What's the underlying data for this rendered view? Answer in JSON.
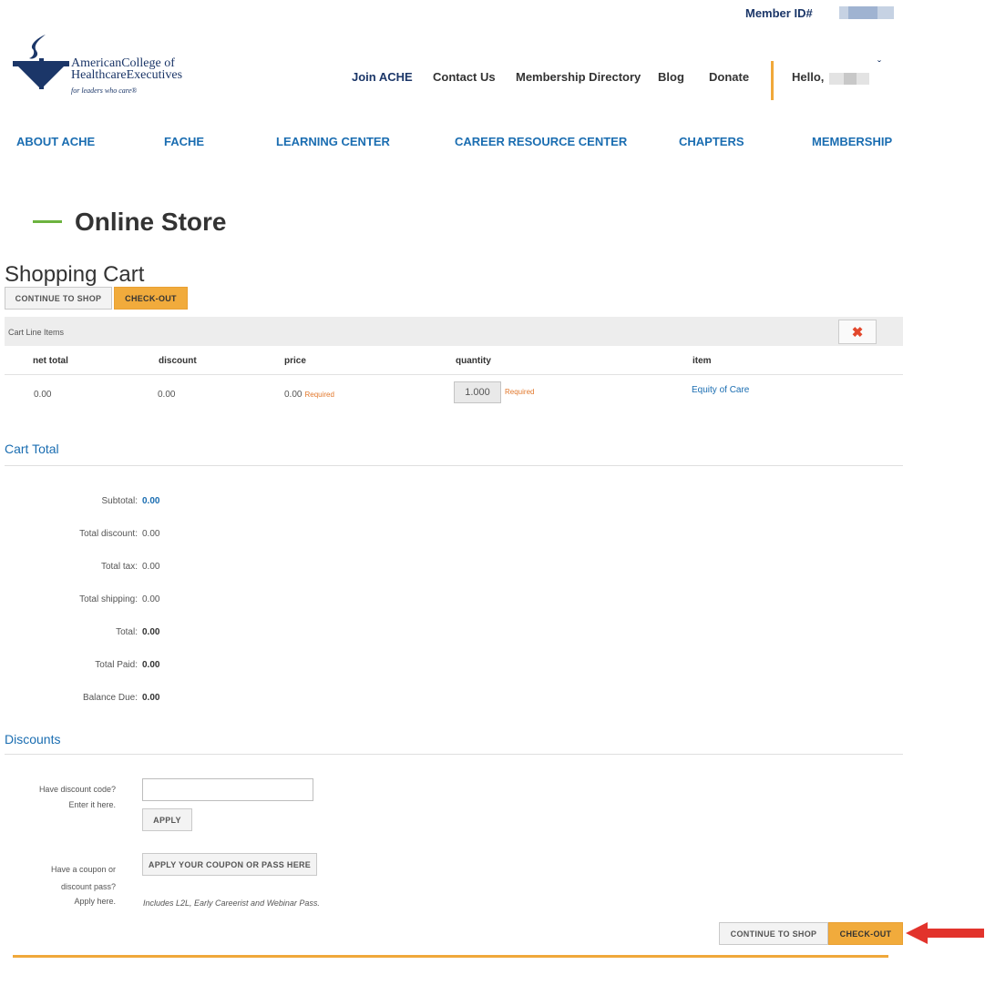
{
  "header": {
    "member_id_label": "Member ID#",
    "logo": {
      "line1": "AmericanCollege of",
      "line2": "HealthcareExecutives",
      "tagline": "for leaders who care®"
    },
    "top_links": [
      "Join ACHE",
      "Contact Us",
      "Membership Directory",
      "Blog",
      "Donate"
    ],
    "greeting": "Hello,"
  },
  "main_nav": [
    "ABOUT ACHE",
    "FACHE",
    "LEARNING CENTER",
    "CAREER RESOURCE CENTER",
    "CHAPTERS",
    "MEMBERSHIP"
  ],
  "page_title": "Online Store",
  "cart": {
    "title": "Shopping Cart",
    "continue_label": "CONTINUE TO SHOP",
    "checkout_label": "CHECK-OUT",
    "line_items_label": "Cart Line Items",
    "delete_icon": "✖",
    "columns": [
      "net total",
      "discount",
      "price",
      "quantity",
      "item"
    ],
    "row": {
      "net_total": "0.00",
      "discount": "0.00",
      "price": "0.00",
      "price_required": "Required",
      "quantity": "1.000",
      "quantity_required": "Required",
      "item": "Equity of Care"
    }
  },
  "cart_total": {
    "title": "Cart Total",
    "rows": [
      {
        "label": "Subtotal:",
        "value": "0.00"
      },
      {
        "label": "Total discount:",
        "value": "0.00"
      },
      {
        "label": "Total tax:",
        "value": "0.00"
      },
      {
        "label": "Total shipping:",
        "value": "0.00"
      },
      {
        "label": "Total:",
        "value": "0.00"
      },
      {
        "label": "Total Paid:",
        "value": "0.00"
      },
      {
        "label": "Balance Due:",
        "value": "0.00"
      }
    ]
  },
  "discounts": {
    "title": "Discounts",
    "code_label_1": "Have discount code?",
    "code_label_2": "Enter it here.",
    "apply_label": "APPLY",
    "coupon_label_1": "Have a coupon or",
    "coupon_label_2": "discount pass?",
    "coupon_label_3": "Apply here.",
    "coupon_button": "APPLY YOUR COUPON OR PASS HERE",
    "coupon_note": "Includes L2L, Early Careerist and Webinar Pass."
  },
  "bottom_buttons": {
    "continue_label": "CONTINUE TO SHOP",
    "checkout_label": "CHECK-OUT"
  },
  "colors": {
    "navy": "#1b3668",
    "link_blue": "#1a6db1",
    "accent_orange": "#f1ab3c",
    "accent_green": "#6cb33f",
    "required_orange": "#e2782c",
    "arrow_red": "#e2332c"
  }
}
